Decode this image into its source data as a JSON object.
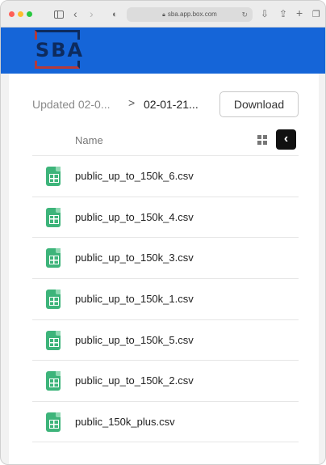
{
  "browser": {
    "url": "sba.app.box.com",
    "icons": [
      "sidebar-icon",
      "back-icon",
      "forward-icon",
      "shield-icon",
      "lock-icon",
      "reload-icon",
      "download-icon",
      "share-icon",
      "plus-icon",
      "tabs-icon"
    ]
  },
  "brand": {
    "logo_text": "SBA",
    "color": "#1565d8"
  },
  "breadcrumb": {
    "parent": "Updated 02-0...",
    "separator": ">",
    "current": "02-01-21..."
  },
  "actions": {
    "download_label": "Download"
  },
  "list": {
    "column_header": "Name",
    "files": [
      {
        "name": "public_up_to_150k_6.csv"
      },
      {
        "name": "public_up_to_150k_4.csv"
      },
      {
        "name": "public_up_to_150k_3.csv"
      },
      {
        "name": "public_up_to_150k_1.csv"
      },
      {
        "name": "public_up_to_150k_5.csv"
      },
      {
        "name": "public_up_to_150k_2.csv"
      },
      {
        "name": "public_150k_plus.csv"
      }
    ]
  },
  "colors": {
    "file_icon": "#3db47a",
    "header_bg": "#1565d8"
  }
}
